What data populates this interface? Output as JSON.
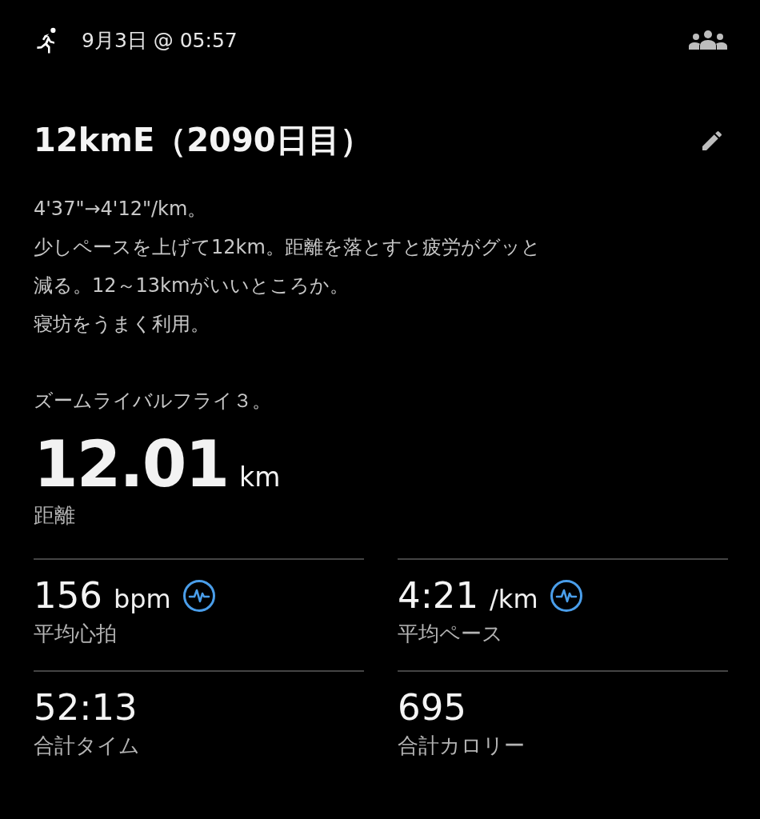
{
  "header": {
    "datetime": "9月3日 @ 05:57"
  },
  "title": "12kmE（2090日目）",
  "notes": [
    "4'37\"→4'12\"/km。",
    "少しペースを上げて12km。距離を落とすと疲労がグッと",
    "減る。12～13kmがいいところか。",
    "寝坊をうまく利用。"
  ],
  "shoe_note": "ズームライバルフライ３。",
  "distance": {
    "value": "12.01",
    "unit": "km",
    "label": "距離"
  },
  "stats": [
    {
      "value": "156",
      "unit": "bpm",
      "label": "平均心拍",
      "graph_link": true
    },
    {
      "value": "4:21",
      "unit": "/km",
      "label": "平均ペース",
      "graph_link": true
    },
    {
      "value": "52:13",
      "label": "合計タイム",
      "graph_link": false
    },
    {
      "value": "695",
      "label": "合計カロリー",
      "graph_link": false
    }
  ]
}
